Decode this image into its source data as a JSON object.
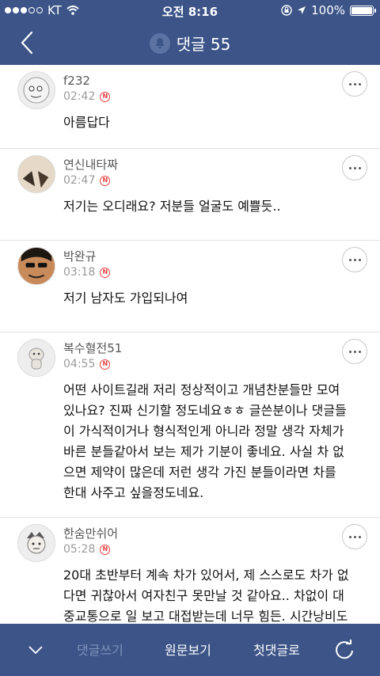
{
  "status_bar": {
    "carrier": "KT",
    "time": "오전 8:16",
    "battery": "100%",
    "battery_level": 1.0
  },
  "header": {
    "title": "댓글 55",
    "back_icon": "chevron-left-icon",
    "bell_icon": "bell-icon"
  },
  "comments": [
    {
      "author": "f232",
      "time": "02:42",
      "badge": "N",
      "text": "아름답다",
      "avatar_icon": "avatar-icon"
    },
    {
      "author": "연신내타짜",
      "time": "02:47",
      "badge": "N",
      "text": "저기는 오디래요? 저분들 얼굴도 예쁠듯..",
      "avatar_icon": "avatar-icon"
    },
    {
      "author": "박완규",
      "time": "03:18",
      "badge": "N",
      "text": "저기 남자도 가입되나여",
      "avatar_icon": "avatar-icon"
    },
    {
      "author": "복수혈전51",
      "time": "04:55",
      "badge": "N",
      "text": "어떤 사이트길래 저리 정상적이고 개념찬분들만 모여\n있나요? 진짜 신기할 정도네요ㅎㅎ 글쓴분이나 댓글들\n이 가식적이거나 형식적인게 아니라 정말 생각 자체가\n바른 분들같아서 보는 제가 기분이 좋네요. 사실 차 없\n으면 제약이 많은데 저런 생각 가진 분들이라면 차를\n한대 사주고 싶을정도네요.",
      "avatar_icon": "avatar-icon"
    },
    {
      "author": "한숨만쉬어",
      "time": "05:28",
      "badge": "N",
      "text": "20대 초반부터 계속 차가 있어서, 제 스스로도 차가 없\n다면 귀찮아서 여자친구 못만날 것 같아요.. 차없이 대\n중교통으로 일 보고 대접받는데 너무 힘든. 시간낭비도",
      "avatar_icon": "avatar-icon"
    }
  ],
  "bottom_bar": {
    "down_icon": "chevron-down-icon",
    "write_label": "댓글쓰기",
    "origin_label": "원문보기",
    "first_label": "첫댓글로",
    "refresh_icon": "refresh-icon"
  },
  "colors": {
    "primary": "#3c5488",
    "new_badge": "#e8403f",
    "disabled_text": "#7f92bb"
  }
}
